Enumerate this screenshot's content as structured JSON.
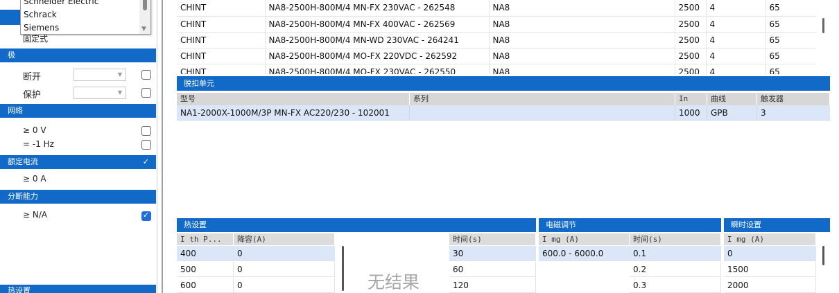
{
  "filters": {
    "manufacturer_list": [
      "Schneider Electric",
      "Schrack",
      "Siemens"
    ],
    "mount_value": "固定式",
    "poles_header": "极",
    "breaking_label": "断开",
    "protection_label": "保护",
    "network_header": "网络",
    "voltage_label": "≥ 0 V",
    "frequency_label": "= -1 Hz",
    "rated_current_header": "额定电流",
    "rated_current_value": "≥ 0 A",
    "breaking_capacity_header": "分断能力",
    "breaking_capacity_value": "≥ N/A",
    "bottom_header": "热设置"
  },
  "main_grid": {
    "rows": [
      [
        "CHINT",
        "NA8-2500H-800M/4 MN-FX 230VAC - 262548",
        "NA8",
        "2500",
        "4",
        "65"
      ],
      [
        "CHINT",
        "NA8-2500H-800M/4 MN-FX 400VAC - 262569",
        "NA8",
        "2500",
        "4",
        "65"
      ],
      [
        "CHINT",
        "NA8-2500H-800M/4 MN-WD 230VAC - 264241",
        "NA8",
        "2500",
        "4",
        "65"
      ],
      [
        "CHINT",
        "NA8-2500H-800M/4 MO-FX 220VDC - 262592",
        "NA8",
        "2500",
        "4",
        "65"
      ],
      [
        "CHINT",
        "NA8-2500H-800M/4 MO-FX 230VAC - 262550",
        "NA8",
        "2500",
        "4",
        "65"
      ]
    ]
  },
  "trip_unit": {
    "title": "脱扣单元",
    "columns": [
      "型号",
      "系列",
      "In",
      "曲线",
      "触发器"
    ],
    "row": [
      "NA1-2000X-1000M/3P MN-FX AC220/230 - 102001",
      "",
      "1000",
      "GPB",
      "3"
    ]
  },
  "thermal": {
    "title": "热设置",
    "columns": [
      "I th P...",
      "降容(A)"
    ],
    "rows": [
      [
        "400",
        "0"
      ],
      [
        "500",
        "0"
      ],
      [
        "600",
        "0"
      ]
    ],
    "time_column": "时间(s)",
    "times": [
      "30",
      "60",
      "120"
    ]
  },
  "magnetic": {
    "title": "电磁调节",
    "columns": [
      "I mg (A)",
      "时间(s)"
    ],
    "range": "600.0 - 6000.0",
    "times": [
      "0.1",
      "0.2",
      "0.3"
    ]
  },
  "instant": {
    "title": "瞬时设置",
    "column": "I mg (A)",
    "values": [
      "0",
      "1500",
      "2000"
    ]
  },
  "no_result_text": "无结果"
}
